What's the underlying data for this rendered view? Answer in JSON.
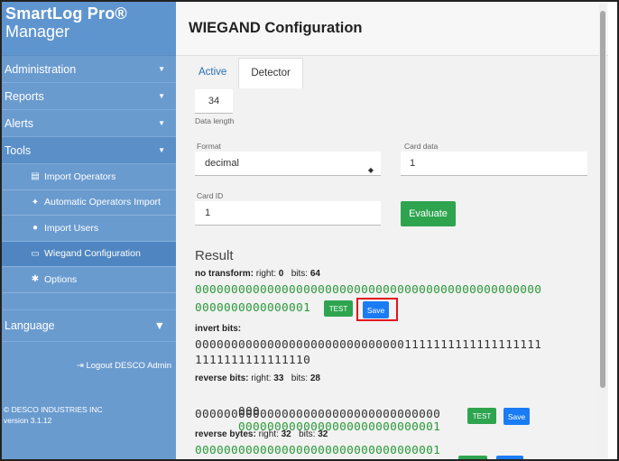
{
  "sidebar": {
    "brand_line1": "SmartLog Pro®",
    "brand_line2": "Manager",
    "nav": [
      {
        "label": "Administration"
      },
      {
        "label": "Reports"
      },
      {
        "label": "Alerts"
      },
      {
        "label": "Tools"
      }
    ],
    "tools_items": [
      {
        "label": "Import Operators",
        "icon": "file-import-icon"
      },
      {
        "label": "Automatic Operators Import",
        "icon": "magic-wand-icon"
      },
      {
        "label": "Import Users",
        "icon": "users-icon"
      },
      {
        "label": "Wiegand Configuration",
        "icon": "id-card-icon"
      },
      {
        "label": "Options",
        "icon": "gear-icon"
      }
    ],
    "language": "Language",
    "logout": "Logout DESCO Admin",
    "copyright": "© DESCO INDUSTRIES INC",
    "version": "version 3.1.12"
  },
  "header": {
    "title": "WIEGAND Configuration"
  },
  "tabs": [
    "Active",
    "Detector"
  ],
  "form": {
    "data_length_value": "34",
    "data_length_label": "Data length",
    "format_label": "Format",
    "format_value": "decimal",
    "card_data_label": "Card data",
    "card_data_value": "1",
    "card_id_label": "Card ID",
    "card_id_value": "1",
    "evaluate_label": "Evaluate"
  },
  "result": {
    "title": "Result",
    "no_transform": {
      "name": "no transform:",
      "right_label": "right:",
      "right": "0",
      "bits_label": "bits:",
      "bits": "64",
      "line1": "000000000000000000000000000000000000000000000000",
      "line2": "0000000000000001"
    },
    "invert_bits": {
      "name": "invert bits:",
      "line1": "000000000000000000000000000001111111111111111111",
      "line2": "1111111111111110"
    },
    "reverse_bits": {
      "name": "reverse bits:",
      "right_label": "right:",
      "right": "33",
      "bits_label": "bits:",
      "bits": "28",
      "line1_dark": "000",
      "line1_green": "0000000000000000000000000001",
      "line2": "0000000000000000000000000000000000"
    },
    "reverse_bytes": {
      "name": "reverse bytes:",
      "right_label": "right:",
      "right": "32",
      "bits_label": "bits:",
      "bits": "32",
      "line1": "0000000000000000000000000000000001"
    },
    "test_label": "TEST",
    "save_label": "Save"
  },
  "colors": {
    "sidebar": "#6a9bcf",
    "bits_green": "#2b9a3a",
    "test_green": "#2ea44f",
    "save_blue": "#1a7cf5",
    "highlight_red": "#e3161d"
  }
}
